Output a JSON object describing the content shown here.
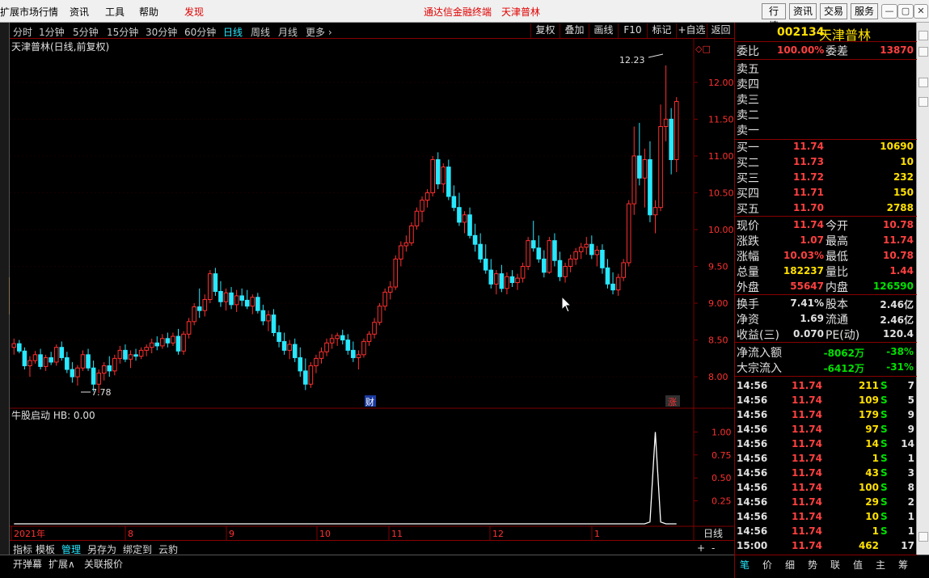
{
  "menubar": {
    "items": [
      "扩展市场行情",
      "资讯",
      "工具",
      "帮助",
      "发现"
    ],
    "center_title": "通达信金融终端",
    "center_stock": "天津普林",
    "right_buttons": [
      "行情",
      "资讯",
      "交易",
      "服务"
    ]
  },
  "periods": [
    "分时",
    "1分钟",
    "5分钟",
    "15分钟",
    "30分钟",
    "60分钟",
    "日线",
    "周线",
    "月线",
    "更多 ›"
  ],
  "active_period": "日线",
  "toolbar": [
    "复权",
    "叠加",
    "画线",
    "F10",
    "标记",
    "+自选",
    "返回"
  ],
  "chart": {
    "title": "天津普林(日线,前复权)",
    "high_label": "12.23",
    "low_label": "7.78",
    "y_ticks": [
      "12.00",
      "11.50",
      "11.00",
      "10.50",
      "10.00",
      "9.50",
      "9.00",
      "8.50",
      "8.00"
    ],
    "marker_cai": "财",
    "marker_zhang": "涨",
    "indicator_title": "牛股启动 HB: 0.00",
    "ind_ticks": [
      "1.00",
      "0.75",
      "0.50",
      "0.25"
    ],
    "x_labels": [
      "2021年",
      "8",
      "9",
      "10",
      "11",
      "12",
      "1"
    ],
    "x_period": "日线",
    "zoom_in": "+",
    "zoom_out": "-",
    "colors": {
      "up": "#ff3030",
      "down": "#28e8ff",
      "grid": "#800000"
    }
  },
  "chart_data": {
    "type": "candlestick",
    "note_units": "price in CNY",
    "ylim": [
      7.65,
      12.35
    ],
    "candles": [
      [
        8.4,
        8.52,
        8.3,
        8.45
      ],
      [
        8.45,
        8.5,
        8.32,
        8.35
      ],
      [
        8.35,
        8.4,
        8.1,
        8.15
      ],
      [
        8.15,
        8.28,
        8.0,
        8.22
      ],
      [
        8.22,
        8.35,
        8.18,
        8.3
      ],
      [
        8.3,
        8.38,
        8.1,
        8.14
      ],
      [
        8.14,
        8.3,
        8.08,
        8.26
      ],
      [
        8.26,
        8.34,
        8.16,
        8.2
      ],
      [
        8.2,
        8.44,
        8.15,
        8.4
      ],
      [
        8.4,
        8.48,
        8.22,
        8.26
      ],
      [
        8.26,
        8.34,
        8.05,
        8.1
      ],
      [
        8.1,
        8.2,
        7.92,
        8.0
      ],
      [
        8.0,
        8.16,
        7.88,
        8.12
      ],
      [
        8.12,
        8.36,
        8.08,
        8.3
      ],
      [
        8.3,
        8.38,
        8.08,
        8.12
      ],
      [
        8.12,
        8.22,
        7.8,
        7.9
      ],
      [
        7.9,
        8.1,
        7.78,
        8.05
      ],
      [
        8.05,
        8.2,
        7.95,
        8.15
      ],
      [
        8.15,
        8.28,
        8.0,
        8.08
      ],
      [
        8.08,
        8.3,
        8.02,
        8.25
      ],
      [
        8.25,
        8.42,
        8.18,
        8.36
      ],
      [
        8.36,
        8.44,
        8.2,
        8.24
      ],
      [
        8.24,
        8.36,
        8.12,
        8.3
      ],
      [
        8.3,
        8.38,
        8.22,
        8.28
      ],
      [
        8.28,
        8.4,
        8.24,
        8.36
      ],
      [
        8.36,
        8.44,
        8.28,
        8.4
      ],
      [
        8.4,
        8.52,
        8.32,
        8.46
      ],
      [
        8.46,
        8.55,
        8.36,
        8.42
      ],
      [
        8.42,
        8.58,
        8.38,
        8.52
      ],
      [
        8.52,
        8.6,
        8.4,
        8.46
      ],
      [
        8.46,
        8.6,
        8.42,
        8.55
      ],
      [
        8.55,
        8.65,
        8.3,
        8.35
      ],
      [
        8.35,
        8.62,
        8.3,
        8.58
      ],
      [
        8.58,
        8.8,
        8.52,
        8.75
      ],
      [
        8.75,
        9.0,
        8.7,
        8.95
      ],
      [
        8.95,
        9.2,
        8.8,
        8.9
      ],
      [
        8.9,
        9.12,
        8.82,
        9.05
      ],
      [
        9.05,
        9.45,
        9.0,
        9.4
      ],
      [
        9.4,
        9.48,
        9.1,
        9.16
      ],
      [
        9.16,
        9.3,
        8.95,
        9.02
      ],
      [
        9.02,
        9.2,
        8.9,
        9.14
      ],
      [
        9.14,
        9.22,
        8.92,
        8.98
      ],
      [
        8.98,
        9.18,
        8.88,
        9.1
      ],
      [
        9.1,
        9.2,
        8.96,
        9.04
      ],
      [
        9.04,
        9.18,
        8.92,
        8.96
      ],
      [
        8.96,
        9.12,
        8.85,
        9.08
      ],
      [
        9.08,
        9.14,
        8.86,
        8.9
      ],
      [
        8.9,
        8.98,
        8.7,
        8.76
      ],
      [
        8.76,
        8.9,
        8.62,
        8.84
      ],
      [
        8.84,
        8.92,
        8.55,
        8.6
      ],
      [
        8.6,
        8.7,
        8.4,
        8.48
      ],
      [
        8.48,
        8.6,
        8.3,
        8.36
      ],
      [
        8.36,
        8.5,
        8.24,
        8.44
      ],
      [
        8.44,
        8.52,
        8.2,
        8.26
      ],
      [
        8.26,
        8.4,
        8.0,
        8.08
      ],
      [
        8.08,
        8.25,
        7.82,
        7.9
      ],
      [
        7.9,
        8.2,
        7.85,
        8.15
      ],
      [
        8.15,
        8.3,
        8.05,
        8.25
      ],
      [
        8.25,
        8.4,
        8.18,
        8.34
      ],
      [
        8.34,
        8.52,
        8.28,
        8.46
      ],
      [
        8.46,
        8.58,
        8.38,
        8.52
      ],
      [
        8.52,
        8.6,
        8.42,
        8.56
      ],
      [
        8.56,
        8.64,
        8.44,
        8.5
      ],
      [
        8.5,
        8.58,
        8.3,
        8.36
      ],
      [
        8.36,
        8.48,
        8.2,
        8.26
      ],
      [
        8.26,
        8.36,
        8.1,
        8.3
      ],
      [
        8.3,
        8.52,
        8.26,
        8.48
      ],
      [
        8.48,
        8.62,
        8.42,
        8.58
      ],
      [
        8.58,
        8.8,
        8.52,
        8.74
      ],
      [
        8.74,
        9.0,
        8.7,
        8.96
      ],
      [
        8.96,
        9.2,
        8.9,
        9.15
      ],
      [
        9.15,
        9.3,
        9.05,
        9.22
      ],
      [
        9.22,
        9.65,
        9.18,
        9.6
      ],
      [
        9.6,
        9.84,
        9.5,
        9.78
      ],
      [
        9.78,
        9.92,
        9.7,
        9.82
      ],
      [
        9.82,
        10.1,
        9.78,
        10.05
      ],
      [
        10.05,
        10.3,
        10.0,
        10.25
      ],
      [
        10.25,
        10.45,
        10.1,
        10.4
      ],
      [
        10.4,
        10.55,
        10.3,
        10.5
      ],
      [
        10.5,
        11.0,
        10.45,
        10.95
      ],
      [
        10.95,
        11.05,
        10.55,
        10.62
      ],
      [
        10.62,
        10.9,
        10.5,
        10.85
      ],
      [
        10.85,
        10.95,
        10.4,
        10.45
      ],
      [
        10.45,
        10.6,
        10.25,
        10.3
      ],
      [
        10.3,
        10.5,
        10.05,
        10.1
      ],
      [
        10.1,
        10.25,
        9.95,
        10.2
      ],
      [
        10.2,
        10.3,
        9.88,
        9.92
      ],
      [
        9.92,
        10.08,
        9.7,
        9.8
      ],
      [
        9.8,
        9.95,
        9.55,
        9.6
      ],
      [
        9.6,
        9.8,
        9.4,
        9.45
      ],
      [
        9.45,
        9.6,
        9.2,
        9.26
      ],
      [
        9.26,
        9.45,
        9.12,
        9.4
      ],
      [
        9.4,
        9.52,
        9.15,
        9.2
      ],
      [
        9.2,
        9.42,
        9.12,
        9.36
      ],
      [
        9.36,
        9.45,
        9.22,
        9.28
      ],
      [
        9.28,
        9.4,
        9.18,
        9.34
      ],
      [
        9.34,
        9.55,
        9.28,
        9.5
      ],
      [
        9.5,
        9.9,
        9.45,
        9.85
      ],
      [
        9.85,
        10.12,
        9.7,
        9.75
      ],
      [
        9.75,
        9.92,
        9.55,
        9.6
      ],
      [
        9.6,
        9.72,
        9.35,
        9.42
      ],
      [
        9.42,
        9.9,
        9.4,
        9.85
      ],
      [
        9.85,
        9.95,
        9.5,
        9.58
      ],
      [
        9.58,
        9.7,
        9.3,
        9.36
      ],
      [
        9.36,
        9.55,
        9.28,
        9.5
      ],
      [
        9.5,
        9.66,
        9.42,
        9.6
      ],
      [
        9.6,
        9.75,
        9.52,
        9.7
      ],
      [
        9.7,
        9.82,
        9.6,
        9.76
      ],
      [
        9.76,
        9.9,
        9.66,
        9.8
      ],
      [
        9.8,
        9.92,
        9.6,
        9.66
      ],
      [
        9.66,
        9.78,
        9.5,
        9.72
      ],
      [
        9.72,
        9.8,
        9.4,
        9.48
      ],
      [
        9.48,
        9.6,
        9.2,
        9.26
      ],
      [
        9.26,
        9.42,
        9.12,
        9.18
      ],
      [
        9.18,
        9.4,
        9.1,
        9.35
      ],
      [
        9.35,
        9.6,
        9.3,
        9.55
      ],
      [
        9.55,
        10.4,
        9.5,
        10.35
      ],
      [
        10.35,
        11.4,
        10.2,
        11.0
      ],
      [
        11.0,
        11.45,
        10.6,
        10.7
      ],
      [
        10.7,
        11.1,
        10.3,
        10.95
      ],
      [
        10.95,
        11.2,
        10.1,
        10.2
      ],
      [
        10.2,
        10.4,
        9.95,
        10.3
      ],
      [
        10.3,
        11.7,
        10.25,
        11.4
      ],
      [
        11.4,
        12.23,
        11.2,
        11.5
      ],
      [
        11.5,
        11.65,
        10.75,
        10.95
      ],
      [
        10.95,
        11.8,
        10.78,
        11.74
      ]
    ],
    "indicator": {
      "name": "牛股启动 HB",
      "value": 0.0,
      "spike_index": 121,
      "spike_value": 1.0,
      "ylim": [
        0,
        1.1
      ]
    }
  },
  "quote": {
    "code": "002134",
    "name": "天津普林",
    "weibi_label": "委比",
    "weibi_value": "100.00%",
    "weicha_label": "委差",
    "weicha_value": "13870",
    "sells": [
      {
        "label": "卖五",
        "price": "",
        "vol": ""
      },
      {
        "label": "卖四",
        "price": "",
        "vol": ""
      },
      {
        "label": "卖三",
        "price": "",
        "vol": ""
      },
      {
        "label": "卖二",
        "price": "",
        "vol": ""
      },
      {
        "label": "卖一",
        "price": "",
        "vol": ""
      }
    ],
    "buys": [
      {
        "label": "买一",
        "price": "11.74",
        "vol": "10690"
      },
      {
        "label": "买二",
        "price": "11.73",
        "vol": "10"
      },
      {
        "label": "买三",
        "price": "11.72",
        "vol": "232"
      },
      {
        "label": "买四",
        "price": "11.71",
        "vol": "150"
      },
      {
        "label": "买五",
        "price": "11.70",
        "vol": "2788"
      }
    ],
    "stats": [
      {
        "l1": "现价",
        "v1": "11.74",
        "c1": "red",
        "l2": "今开",
        "v2": "10.78",
        "c2": "red"
      },
      {
        "l1": "涨跌",
        "v1": "1.07",
        "c1": "red",
        "l2": "最高",
        "v2": "11.74",
        "c2": "red"
      },
      {
        "l1": "涨幅",
        "v1": "10.03%",
        "c1": "red",
        "l2": "最低",
        "v2": "10.78",
        "c2": "red"
      },
      {
        "l1": "总量",
        "v1": "182237",
        "c1": "yel",
        "l2": "量比",
        "v2": "1.44",
        "c2": "red"
      },
      {
        "l1": "外盘",
        "v1": "55647",
        "c1": "red",
        "l2": "内盘",
        "v2": "126590",
        "c2": "grn"
      }
    ],
    "fund": [
      {
        "l1": "换手",
        "v1": "7.41%",
        "l2": "股本",
        "v2": "2.46亿"
      },
      {
        "l1": "净资",
        "v1": "1.69",
        "l2": "流通",
        "v2": "2.46亿"
      },
      {
        "l1": "收益(三)",
        "v1": "0.070",
        "l2": "PE(动)",
        "v2": "120.4"
      }
    ],
    "flows": [
      {
        "label": "净流入额",
        "value": "-8062万",
        "pct": "-38%"
      },
      {
        "label": "大宗流入",
        "value": "-6412万",
        "pct": "-31%"
      }
    ],
    "ticks": [
      {
        "t": "14:56",
        "p": "11.74",
        "v": "211",
        "s": "S",
        "n": "7"
      },
      {
        "t": "14:56",
        "p": "11.74",
        "v": "109",
        "s": "S",
        "n": "5"
      },
      {
        "t": "14:56",
        "p": "11.74",
        "v": "179",
        "s": "S",
        "n": "9"
      },
      {
        "t": "14:56",
        "p": "11.74",
        "v": "97",
        "s": "S",
        "n": "9"
      },
      {
        "t": "14:56",
        "p": "11.74",
        "v": "14",
        "s": "S",
        "n": "14"
      },
      {
        "t": "14:56",
        "p": "11.74",
        "v": "1",
        "s": "S",
        "n": "1"
      },
      {
        "t": "14:56",
        "p": "11.74",
        "v": "43",
        "s": "S",
        "n": "3"
      },
      {
        "t": "14:56",
        "p": "11.74",
        "v": "100",
        "s": "S",
        "n": "8"
      },
      {
        "t": "14:56",
        "p": "11.74",
        "v": "29",
        "s": "S",
        "n": "2"
      },
      {
        "t": "14:56",
        "p": "11.74",
        "v": "10",
        "s": "S",
        "n": "1"
      },
      {
        "t": "14:56",
        "p": "11.74",
        "v": "1",
        "s": "S",
        "n": "1"
      },
      {
        "t": "15:00",
        "p": "11.74",
        "v": "462",
        "s": "",
        "n": "17"
      }
    ],
    "tabs": [
      "笔",
      "价",
      "细",
      "势",
      "联",
      "值",
      "主",
      "筹"
    ]
  },
  "bottom_tabs": [
    "指标",
    "模板",
    "管理",
    "另存为",
    "绑定到",
    "云豹"
  ],
  "active_bottom_tab": "管理",
  "status": [
    "开弹幕",
    "扩展∧",
    "关联报价"
  ]
}
